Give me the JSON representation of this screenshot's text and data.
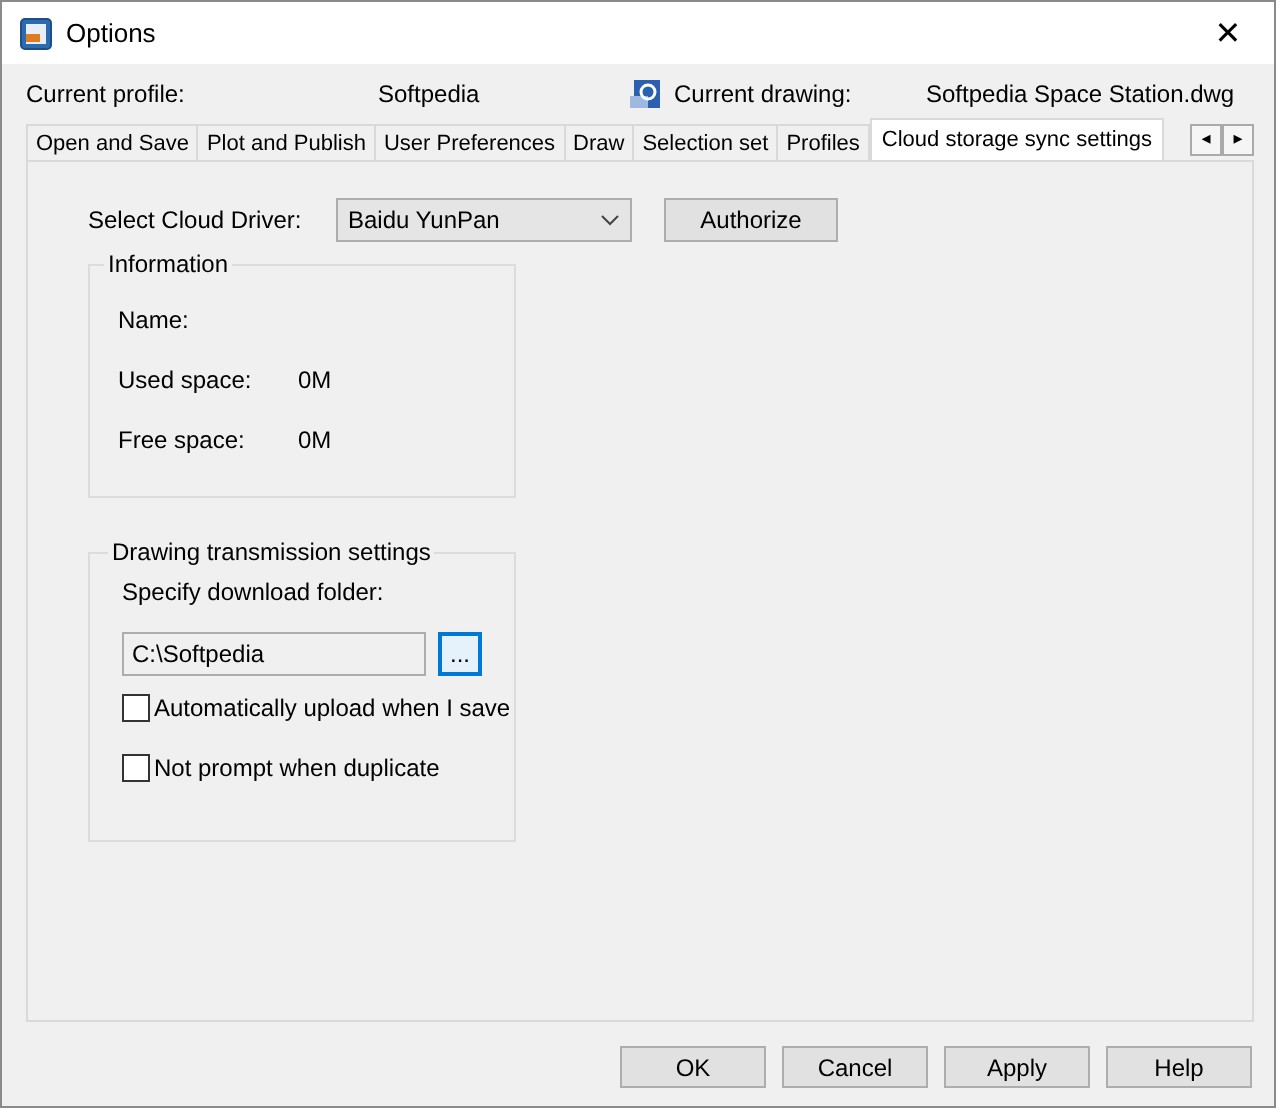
{
  "window": {
    "title": "Options",
    "close": "✕"
  },
  "profile": {
    "label": "Current profile:",
    "value": "Softpedia",
    "drawing_label": "Current drawing:",
    "drawing_value": "Softpedia Space Station.dwg"
  },
  "tabs": [
    {
      "label": "Open and Save",
      "selected": false
    },
    {
      "label": "Plot and Publish",
      "selected": false
    },
    {
      "label": "User Preferences",
      "selected": false
    },
    {
      "label": "Draw",
      "selected": false
    },
    {
      "label": "Selection set",
      "selected": false
    },
    {
      "label": "Profiles",
      "selected": false
    },
    {
      "label": "Cloud storage sync settings",
      "selected": true
    }
  ],
  "tab_scroll": [
    "◂",
    "▸"
  ],
  "cloud": {
    "label": "Select Cloud Driver:",
    "driver": "Baidu YunPan",
    "authorize": "Authorize"
  },
  "information": {
    "title": "Information",
    "rows": [
      {
        "label": "Name:"
      },
      {
        "label": "Used space:",
        "value": "0M"
      },
      {
        "label": "Free space:",
        "value": "0M"
      }
    ]
  },
  "transmission": {
    "title": "Drawing transmission settings",
    "folder_label": "Specify download folder:",
    "folder": "C:\\Softpedia",
    "browse": "...",
    "options": [
      {
        "label": "Automatically upload when I save",
        "checked": false
      },
      {
        "label": "Not prompt when duplicate",
        "checked": false
      }
    ]
  },
  "buttons": [
    "OK",
    "Cancel",
    "Apply",
    "Help"
  ]
}
